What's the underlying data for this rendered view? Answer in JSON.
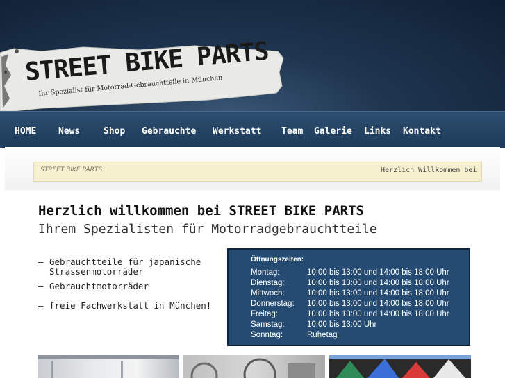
{
  "logo": {
    "title": "STREET BIKE PARTS",
    "subtitle": "Ihr Spezialist für Motorrad-Gebrauchtteile in München"
  },
  "nav": {
    "items": [
      {
        "label": "HOME"
      },
      {
        "label": "News"
      },
      {
        "label": "Shop"
      },
      {
        "label": "Gebrauchte"
      },
      {
        "label": "Werkstatt"
      },
      {
        "label": "Team"
      },
      {
        "label": "Galerie"
      },
      {
        "label": "Links"
      },
      {
        "label": "Kontakt"
      }
    ]
  },
  "ticker": {
    "logo_text": "STREET BIKE PARTS",
    "message": "Herzlich Willkommen bei"
  },
  "main": {
    "heading": "Herzlich willkommen bei STREET BIKE PARTS",
    "subheading": "Ihrem Spezialisten für Motorradgebrauchtteile",
    "features": [
      {
        "line1": "Gebrauchtteile für japanische",
        "line2": "Strassenmotorräder"
      },
      {
        "line1": "Gebrauchtmotorräder",
        "line2": ""
      },
      {
        "line1": "freie Fachwerkstatt in München!",
        "line2": ""
      }
    ],
    "bullet": "—"
  },
  "hours": {
    "title": "Öffnungszeiten:",
    "rows": [
      {
        "day": "Montag:",
        "time": "10:00 bis 13:00 und 14:00 bis 18:00 Uhr"
      },
      {
        "day": "Dienstag:",
        "time": "10:00 bis 13:00 und 14:00 bis 18:00 Uhr"
      },
      {
        "day": "Mittwoch:",
        "time": "10:00 bis 13:00 und 14:00 bis 18:00 Uhr"
      },
      {
        "day": "Donnerstag:",
        "time": "10:00 bis 13:00 und 14:00 bis 18:00 Uhr"
      },
      {
        "day": "Freitag:",
        "time": "10:00 bis 13:00 und 14:00 bis 18:00 Uhr"
      },
      {
        "day": "Samstag:",
        "time": "10:00 bis 13:00 Uhr"
      },
      {
        "day": "Sonntag:",
        "time": "Ruhetag"
      }
    ]
  },
  "colors": {
    "header_dark": "#0f1f33",
    "nav_blue": "#2e4f70",
    "hours_bg": "#264b72",
    "ticker_bg": "#f6f0cf"
  }
}
